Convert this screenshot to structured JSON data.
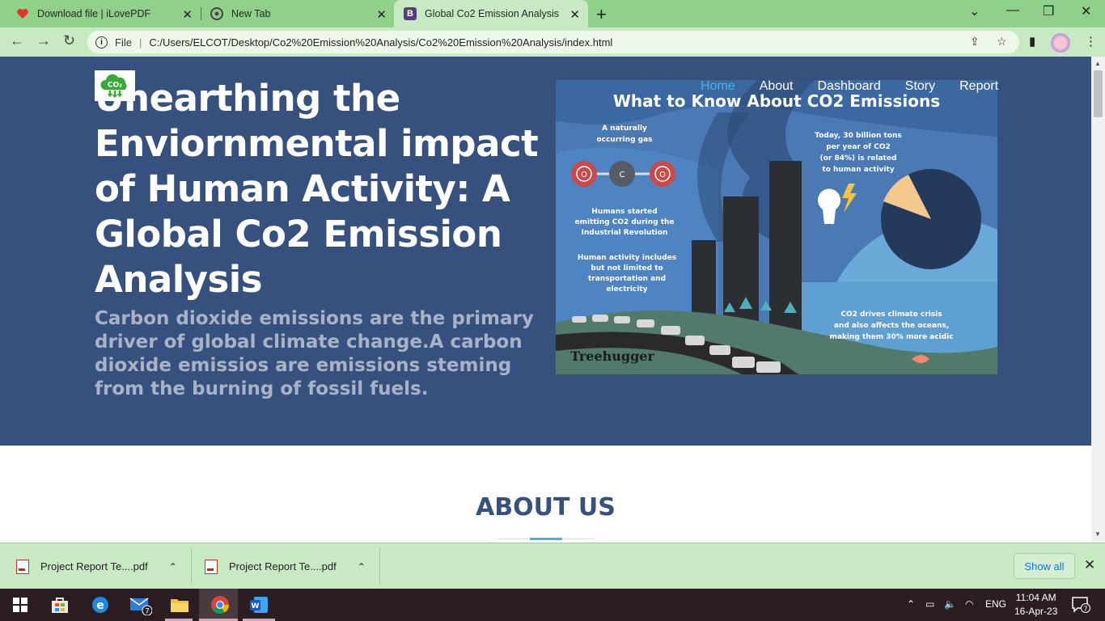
{
  "browser": {
    "tabs": [
      {
        "title": "Download file | iLovePDF",
        "icon": "heart-icon"
      },
      {
        "title": "New Tab",
        "icon": "chrome-icon"
      },
      {
        "title": "Global Co2 Emission Analysis",
        "icon": "bootstrap-icon"
      }
    ],
    "address": {
      "scheme_label": "File",
      "url": "C:/Users/ELCOT/Desktop/Co2%20Emission%20Analysis/Co2%20Emission%20Analysis/index.html"
    }
  },
  "page": {
    "logo_text": "CO₂",
    "nav": [
      "Home",
      "About",
      "Dashboard",
      "Story",
      "Report"
    ],
    "hero_title": "Unearthing the Enviornmental impact of Human Activity: A Global Co2 Emission Analysis",
    "hero_subtitle": "Carbon dioxide emissions are the primary driver of global climate change.A carbon dioxide emissios are emissions steming from the burning of fossil fuels.",
    "infographic": {
      "title": "What to Know About CO2 Emissions",
      "t1": "A naturally",
      "t2": "occurring gas",
      "atom_o": "O",
      "atom_c": "C",
      "h1": "Humans started",
      "h2": "emitting CO2 during the",
      "h3": "Industrial Revolution",
      "a1": "Human activity includes",
      "a2": "but not limited to",
      "a3": "transportation and",
      "a4": "electricity",
      "b1": "Today, 30 billion tons",
      "b2": "per year of CO2",
      "b3": "(or 84%) is related",
      "b4": "to human activity",
      "o1": "CO2 drives climate crisis",
      "o2": "and also affects the oceans,",
      "o3": "making them 30% more acidic",
      "brand": "Treehugger"
    },
    "about_heading": "ABOUT US"
  },
  "downloads": {
    "items": [
      "Project Report Te....pdf",
      "Project Report Te....pdf"
    ],
    "show_all": "Show all"
  },
  "taskbar": {
    "mail_badge": "7",
    "language": "ENG",
    "time": "11:04 AM",
    "date": "16-Apr-23",
    "notification_count": "7"
  },
  "colors": {
    "hero_bg": "#37517e",
    "accent": "#47b2e4",
    "chrome_frame": "#8fd18a",
    "chrome_toolbar": "#c7eac2"
  }
}
